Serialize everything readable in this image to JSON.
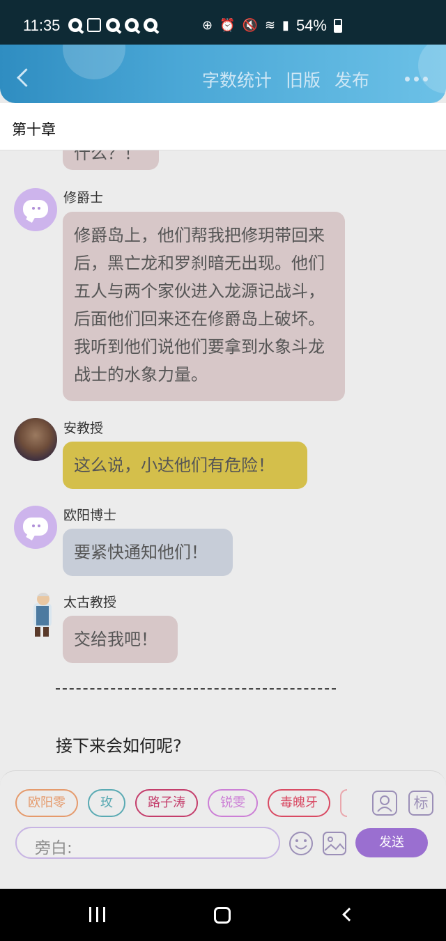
{
  "status_bar": {
    "time": "11:35",
    "battery": "54%"
  },
  "header": {
    "actions": [
      "字数统计",
      "旧版",
      "发布"
    ]
  },
  "chapter": {
    "title": "第十章"
  },
  "messages": [
    {
      "text": "什么？！"
    },
    {
      "name": "修爵士",
      "text": "修爵岛上，他们帮我把修玥带回来后，黑亡龙和罗刹暗无出现。他们五人与两个家伙进入龙源记战斗，后面他们回来还在修爵岛上破坏。我听到他们说他们要拿到水象斗龙战士的水象力量。"
    },
    {
      "name": "安教授",
      "text": "这么说，小达他们有危险！"
    },
    {
      "name": "欧阳博士",
      "text": "要紧快通知他们！"
    },
    {
      "name": "太古教授",
      "text": "交给我吧！"
    }
  ],
  "divider": "----------------------------------------------------------",
  "next_text": "接下来会如何呢?",
  "composer": {
    "chips": [
      {
        "label": "欧阳零",
        "color": "#e59a6c"
      },
      {
        "label": "玫",
        "color": "#5aaab3"
      },
      {
        "label": "路子涛",
        "color": "#c43d6b"
      },
      {
        "label": "锐雯",
        "color": "#cc7fd6"
      },
      {
        "label": "毒魄牙",
        "color": "#d94a63"
      }
    ],
    "tag_icon_label": "标",
    "input_label": "旁白:",
    "send_label": "发送"
  },
  "colors": {
    "header_gradient_start": "#2f8dc1",
    "header_gradient_end": "#6cc1e7",
    "bubble_pink": "#d7c7c8",
    "bubble_yellow": "#d4bf4b",
    "bubble_gray": "#c7cdd8",
    "send_button": "#9a6fd0"
  }
}
